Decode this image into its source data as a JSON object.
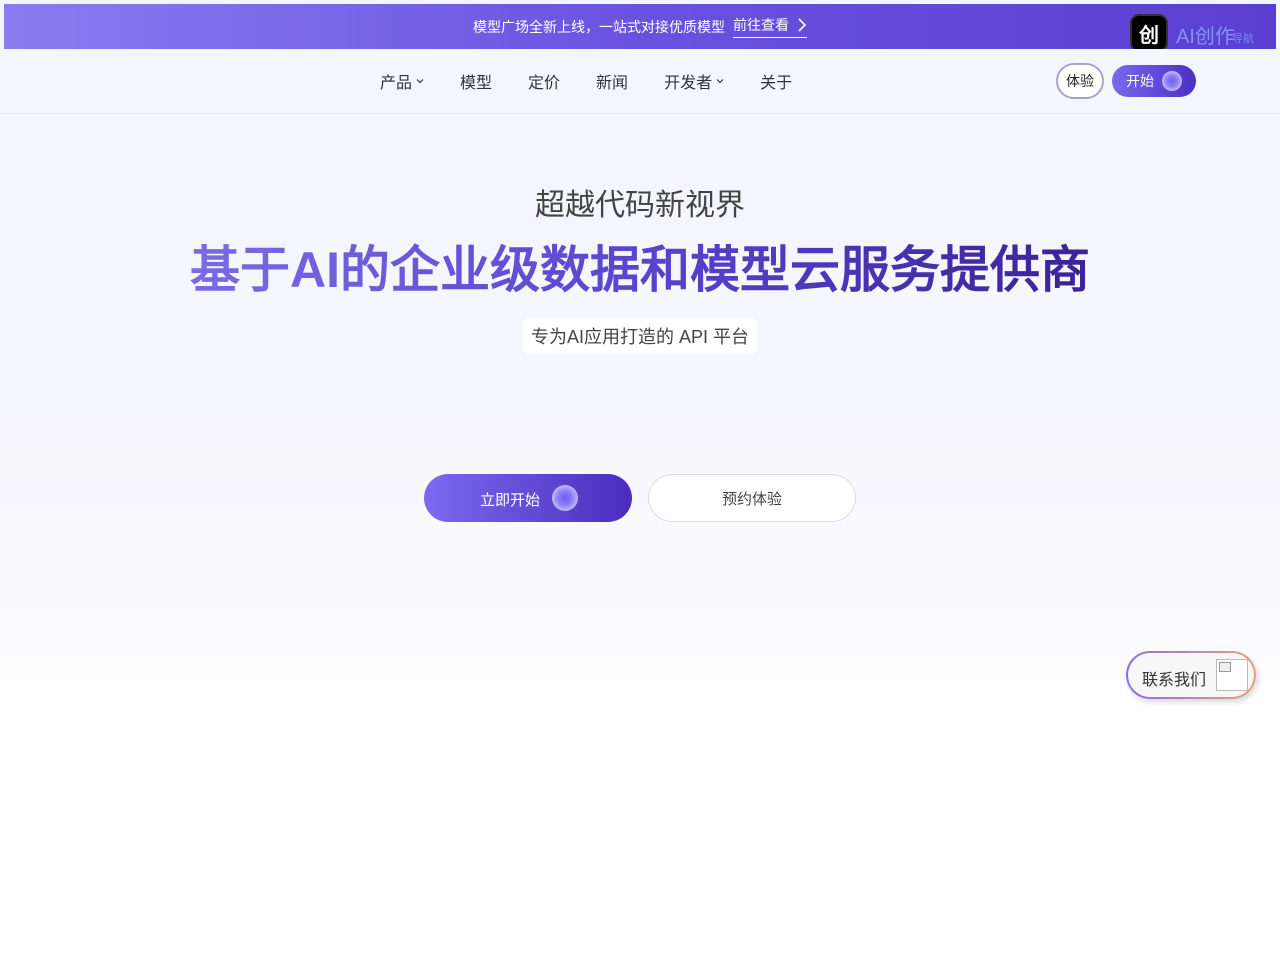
{
  "announcement": {
    "text": "模型广场全新上线，一站式对接优质模型",
    "link_label": "前往查看"
  },
  "brand": {
    "badge_glyph": "创",
    "name": "AI创作",
    "sub": "导航"
  },
  "nav": {
    "items": [
      {
        "label": "产品",
        "has_dropdown": true
      },
      {
        "label": "模型",
        "has_dropdown": false
      },
      {
        "label": "定价",
        "has_dropdown": false
      },
      {
        "label": "新闻",
        "has_dropdown": false
      },
      {
        "label": "开发者",
        "has_dropdown": true
      },
      {
        "label": "关于",
        "has_dropdown": false
      }
    ],
    "try_label": "体验",
    "start_label": "开始"
  },
  "hero": {
    "subtitle": "超越代码新视界",
    "title": "基于AI的企业级数据和模型云服务提供商",
    "tagline": "专为AI应用打造的 API 平台",
    "cta_start": "立即开始",
    "cta_reserve": "预约体验"
  },
  "contact": {
    "label": "联系我们"
  },
  "colors": {
    "accent_start": "#7c6af0",
    "accent_end": "#4a2dbb"
  }
}
